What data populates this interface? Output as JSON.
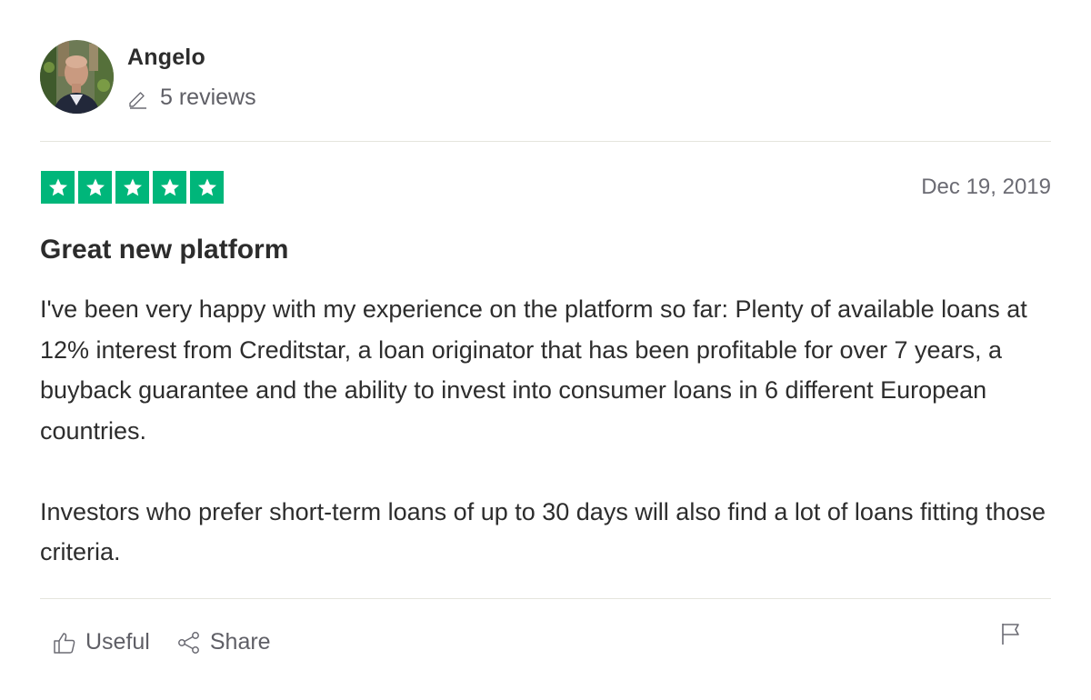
{
  "author": {
    "name": "Angelo",
    "reviews_label": "5 reviews"
  },
  "review": {
    "rating": 5,
    "max_rating": 5,
    "date": "Dec 19, 2019",
    "title": "Great new platform",
    "paragraphs": [
      "I've been very happy with my experience on the platform so far: Plenty of available loans at 12% interest from Creditstar, a loan originator that has been profitable for over 7 years, a buyback guarantee and the ability to invest into consumer loans in 6 different European countries.",
      "Investors who prefer short-term loans of up to 30 days will also find a lot of loans fitting those criteria."
    ]
  },
  "actions": {
    "useful_label": "Useful",
    "share_label": "Share"
  },
  "icons": {
    "reviews": "pencil-icon",
    "star": "star-icon",
    "useful": "thumbs-up-icon",
    "share": "share-icon",
    "report": "flag-icon"
  },
  "colors": {
    "star_green": "#00b67a"
  }
}
